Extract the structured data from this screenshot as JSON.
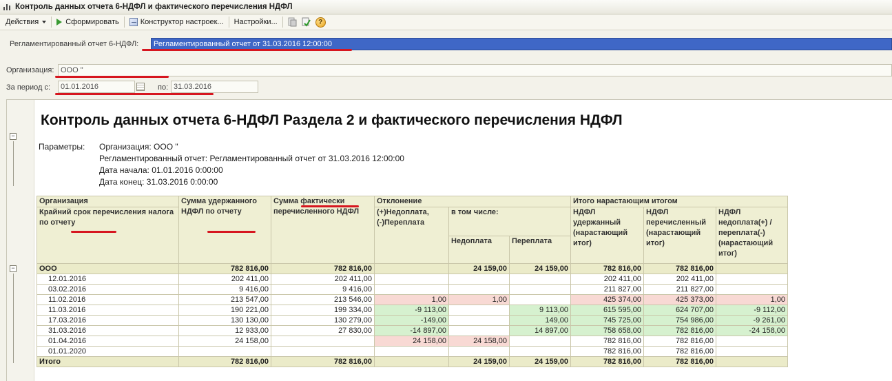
{
  "window": {
    "title": "Контроль данных отчета 6-НДФЛ и фактического перечисления НДФЛ"
  },
  "toolbar": {
    "actions_label": "Действия",
    "generate_label": "Сформировать",
    "constructor_label": "Конструктор настроек...",
    "settings_label": "Настройки..."
  },
  "form": {
    "report_label": "Регламентированный отчет 6-НДФЛ:",
    "report_value": "Регламентированный отчет от 31.03.2016 12:00:00",
    "org_label": "Организация:",
    "org_value": "ООО \"",
    "period_label": "За период с:",
    "period_from": "01.01.2016",
    "period_to_label": "по:",
    "period_to": "31.03.2016"
  },
  "report": {
    "title": "Контроль данных отчета 6-НДФЛ Раздела 2 и фактического перечисления НДФЛ",
    "params_label": "Параметры:",
    "params": [
      "Организация: ООО \"",
      "Регламентированный отчет: Регламентированный отчет от 31.03.2016 12:00:00",
      "Дата начала: 01.01.2016 0:00:00",
      "Дата конец: 31.03.2016 0:00:00"
    ],
    "headers": {
      "org": "Организация",
      "deadline": "Крайний срок перечисления налога по отчету",
      "withheld": "Сумма удержанного НДФЛ по отчету",
      "paid": "Сумма фактически перечисленного НДФЛ",
      "deviation": "Отклонение",
      "deviation_sub": "(+)Недоплата, (-)Переплата",
      "including": "в том числе:",
      "underpay": "Недоплата",
      "overpay": "Переплата",
      "cumulative": "Итого нарастающим итогом",
      "cum_withheld": "НДФЛ удержанный (нарастающий итог)",
      "cum_paid": "НДФЛ перечисленный (нарастающий итог)",
      "cum_diff": "НДФЛ недоплата(+) / переплата(-) (нарастающий итог)"
    },
    "group": {
      "name": "ООО",
      "withheld": "782 816,00",
      "paid": "782 816,00",
      "deviation": "",
      "underpay": "24 159,00",
      "overpay": "24 159,00",
      "cum_withheld": "782 816,00",
      "cum_paid": "782 816,00",
      "cum_diff": ""
    },
    "rows": [
      {
        "date": "12.01.2016",
        "withheld": "202 411,00",
        "paid": "202 411,00",
        "deviation": "",
        "underpay": "",
        "overpay": "",
        "cum_withheld": "202 411,00",
        "cum_paid": "202 411,00",
        "cum_diff": ""
      },
      {
        "date": "03.02.2016",
        "withheld": "9 416,00",
        "paid": "9 416,00",
        "deviation": "",
        "underpay": "",
        "overpay": "",
        "cum_withheld": "211 827,00",
        "cum_paid": "211 827,00",
        "cum_diff": ""
      },
      {
        "date": "11.02.2016",
        "withheld": "213 547,00",
        "paid": "213 546,00",
        "deviation": "1,00",
        "underpay": "1,00",
        "overpay": "",
        "cum_withheld": "425 374,00",
        "cum_paid": "425 373,00",
        "cum_diff": "1,00"
      },
      {
        "date": "11.03.2016",
        "withheld": "190 221,00",
        "paid": "199 334,00",
        "deviation": "-9 113,00",
        "underpay": "",
        "overpay": "9 113,00",
        "cum_withheld": "615 595,00",
        "cum_paid": "624 707,00",
        "cum_diff": "-9 112,00"
      },
      {
        "date": "17.03.2016",
        "withheld": "130 130,00",
        "paid": "130 279,00",
        "deviation": "-149,00",
        "underpay": "",
        "overpay": "149,00",
        "cum_withheld": "745 725,00",
        "cum_paid": "754 986,00",
        "cum_diff": "-9 261,00"
      },
      {
        "date": "31.03.2016",
        "withheld": "12 933,00",
        "paid": "27 830,00",
        "deviation": "-14 897,00",
        "underpay": "",
        "overpay": "14 897,00",
        "cum_withheld": "758 658,00",
        "cum_paid": "782 816,00",
        "cum_diff": "-24 158,00"
      },
      {
        "date": "01.04.2016",
        "withheld": "24 158,00",
        "paid": "",
        "deviation": "24 158,00",
        "underpay": "24 158,00",
        "overpay": "",
        "cum_withheld": "782 816,00",
        "cum_paid": "782 816,00",
        "cum_diff": ""
      },
      {
        "date": "01.01.2020",
        "withheld": "",
        "paid": "",
        "deviation": "",
        "underpay": "",
        "overpay": "",
        "cum_withheld": "782 816,00",
        "cum_paid": "782 816,00",
        "cum_diff": ""
      }
    ],
    "total": {
      "label": "Итого",
      "withheld": "782 816,00",
      "paid": "782 816,00",
      "deviation": "",
      "underpay": "24 159,00",
      "overpay": "24 159,00",
      "cum_withheld": "782 816,00",
      "cum_paid": "782 816,00",
      "cum_diff": ""
    }
  },
  "colors": {
    "header_bg": "#efefd3",
    "underpay_bg": "#f8d9d4",
    "overpay_bg": "#d6f1cf",
    "annotation_red": "#d6161f",
    "selection_blue": "#3f67c6"
  }
}
